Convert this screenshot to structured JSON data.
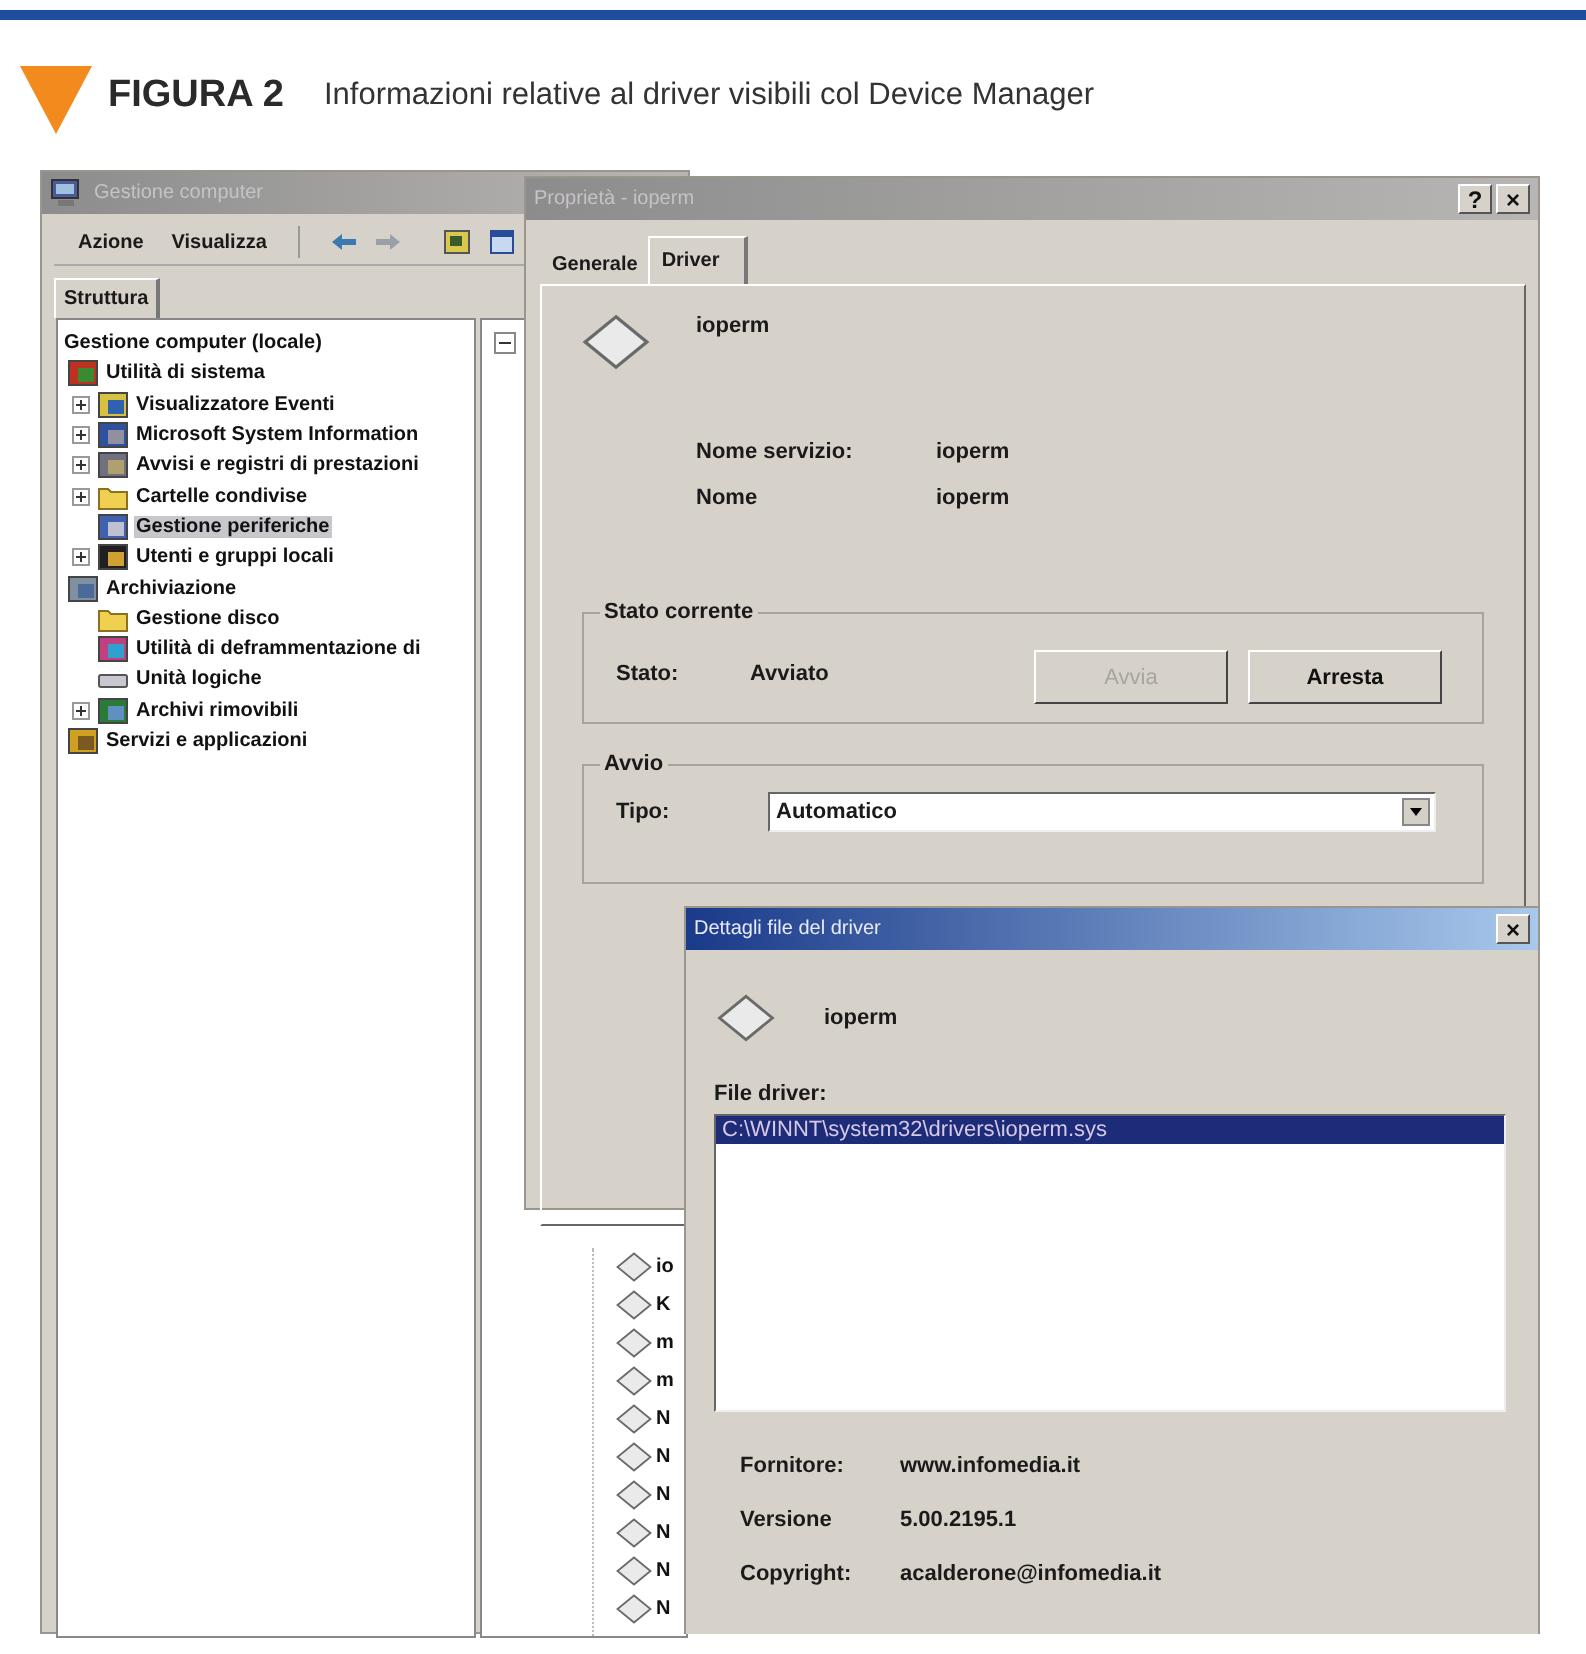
{
  "header": {
    "figure_label": "FIGURA 2",
    "caption": "Informazioni relative al driver visibili col Device Manager"
  },
  "computer_management": {
    "title": "Gestione computer",
    "active": false,
    "menu": [
      {
        "label": "Azione"
      },
      {
        "label": "Visualizza"
      }
    ],
    "tree_tab": {
      "label": "Struttura",
      "selected": true
    },
    "tree": [
      {
        "label": "Gestione computer (locale)",
        "selected": false,
        "children": [
          {
            "label": "Utilità di sistema",
            "selected": false,
            "children": [
              {
                "label": "Visualizzatore Eventi",
                "selected": false,
                "collapsed": true
              },
              {
                "label": "Microsoft System Information",
                "selected": false,
                "collapsed": true
              },
              {
                "label": "Avvisi e registri di prestazioni",
                "selected": false,
                "collapsed": true
              },
              {
                "label": "Cartelle condivise",
                "selected": false,
                "collapsed": true
              },
              {
                "label": "Gestione periferiche",
                "selected": true,
                "collapsed": false
              },
              {
                "label": "Utenti e gruppi locali",
                "selected": false,
                "collapsed": true
              }
            ]
          },
          {
            "label": "Archiviazione",
            "selected": false,
            "children": [
              {
                "label": "Gestione disco",
                "selected": false,
                "collapsed": false
              },
              {
                "label": "Utilità di deframmentazione di",
                "selected": false,
                "collapsed": false
              },
              {
                "label": "Unità logiche",
                "selected": false,
                "collapsed": false
              },
              {
                "label": "Archivi rimovibili",
                "selected": false,
                "collapsed": true
              }
            ]
          },
          {
            "label": "Servizi e applicazioni",
            "selected": false
          }
        ]
      }
    ],
    "list_rows": [
      {
        "label": "io"
      },
      {
        "label": "K"
      },
      {
        "label": "m"
      },
      {
        "label": "m"
      },
      {
        "label": "N"
      },
      {
        "label": "N"
      },
      {
        "label": "N"
      },
      {
        "label": "N"
      },
      {
        "label": "N"
      },
      {
        "label": "N"
      }
    ]
  },
  "properties": {
    "title": "Proprietà - ioperm",
    "active": false,
    "title_buttons": [
      "?",
      "×"
    ],
    "tabs": [
      {
        "label": "Generale",
        "selected": false
      },
      {
        "label": "Driver",
        "selected": true
      }
    ],
    "driver_name": "ioperm",
    "fields": [
      {
        "label": "Nome servizio:",
        "value": "ioperm"
      },
      {
        "label": "Nome",
        "value": "ioperm"
      }
    ],
    "status_group": {
      "title": "Stato corrente",
      "label": "Stato:",
      "value": "Avviato",
      "buttons": [
        {
          "label": "Avvia",
          "disabled": true
        },
        {
          "label": "Arresta",
          "disabled": false
        }
      ]
    },
    "startup_group": {
      "title": "Avvio",
      "label": "Tipo:",
      "value": "Automatico"
    }
  },
  "details": {
    "title": "Dettagli file del driver",
    "active": true,
    "close_button": "×",
    "driver_name": "ioperm",
    "files_label": "File driver:",
    "files": [
      {
        "path": "C:\\WINNT\\system32\\drivers\\ioperm.sys",
        "selected": true
      }
    ],
    "info": [
      {
        "label": "Fornitore:",
        "value": "www.infomedia.it"
      },
      {
        "label": "Versione",
        "value": "5.00.2195.1"
      },
      {
        "label": "Copyright:",
        "value": "acalderone@infomedia.it"
      }
    ]
  }
}
